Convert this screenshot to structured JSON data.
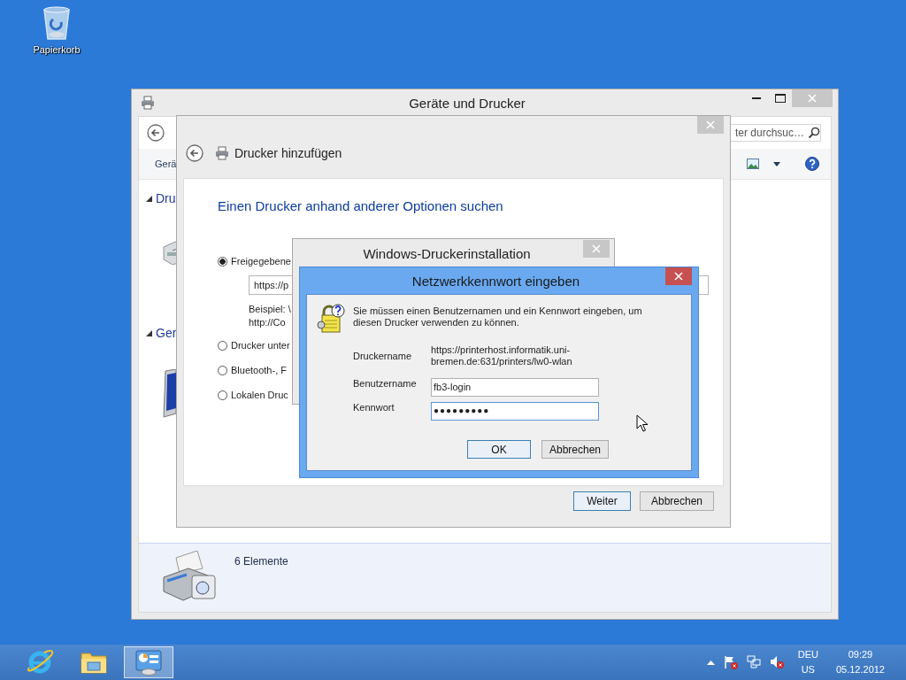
{
  "desktop": {
    "icons": [
      {
        "label": "Papierkorb"
      }
    ]
  },
  "main_window": {
    "title": "Geräte und Drucker",
    "search": {
      "placeholder": "ter durchsuc…"
    },
    "toolbar": {
      "items": [
        "Gerä"
      ]
    },
    "groups": [
      {
        "label": "Dru",
        "expanded": true
      },
      {
        "label": "Ger",
        "expanded": true
      }
    ],
    "details": {
      "count": "6 Elemente"
    }
  },
  "wizard": {
    "title": "Drucker hinzufügen",
    "heading": "Einen Drucker anhand anderer Optionen suchen",
    "options": [
      {
        "label": "Freigegebene",
        "selected": true
      },
      {
        "label": "Drucker unter",
        "selected": false
      },
      {
        "label": "Bluetooth-, F",
        "selected": false
      },
      {
        "label": "Lokalen Druc",
        "selected": false
      }
    ],
    "path_field": {
      "value": "https://p"
    },
    "example": [
      "Beispiel: \\",
      "http://Co"
    ],
    "buttons": [
      {
        "label": "Weiter",
        "default": true
      },
      {
        "label": "Abbrechen",
        "default": false
      }
    ]
  },
  "installer": {
    "title": "Windows-Druckerinstallation"
  },
  "password_dialog": {
    "title": "Netzwerkkennwort eingeben",
    "message": "Sie müssen einen Benutzernamen und ein Kennwort eingeben, um diesen Drucker verwenden zu können.",
    "printer": {
      "label": "Druckername",
      "value": "https://printerhost.informatik.uni-bremen.de:631/printers/lw0-wlan"
    },
    "fields": [
      {
        "label": "Benutzername",
        "value": "fb3-login",
        "focused": false
      },
      {
        "label": "Kennwort",
        "value": "●●●●●●●●●",
        "focused": true
      }
    ],
    "buttons": [
      {
        "label": "OK",
        "default": true
      },
      {
        "label": "Abbrechen",
        "default": false
      }
    ]
  },
  "taskbar": {
    "apps": [
      {
        "selected": false
      },
      {
        "selected": false
      },
      {
        "selected": true
      }
    ],
    "language": [
      "DEU",
      "US"
    ],
    "time": "09:29",
    "date": "05.12.2012"
  }
}
